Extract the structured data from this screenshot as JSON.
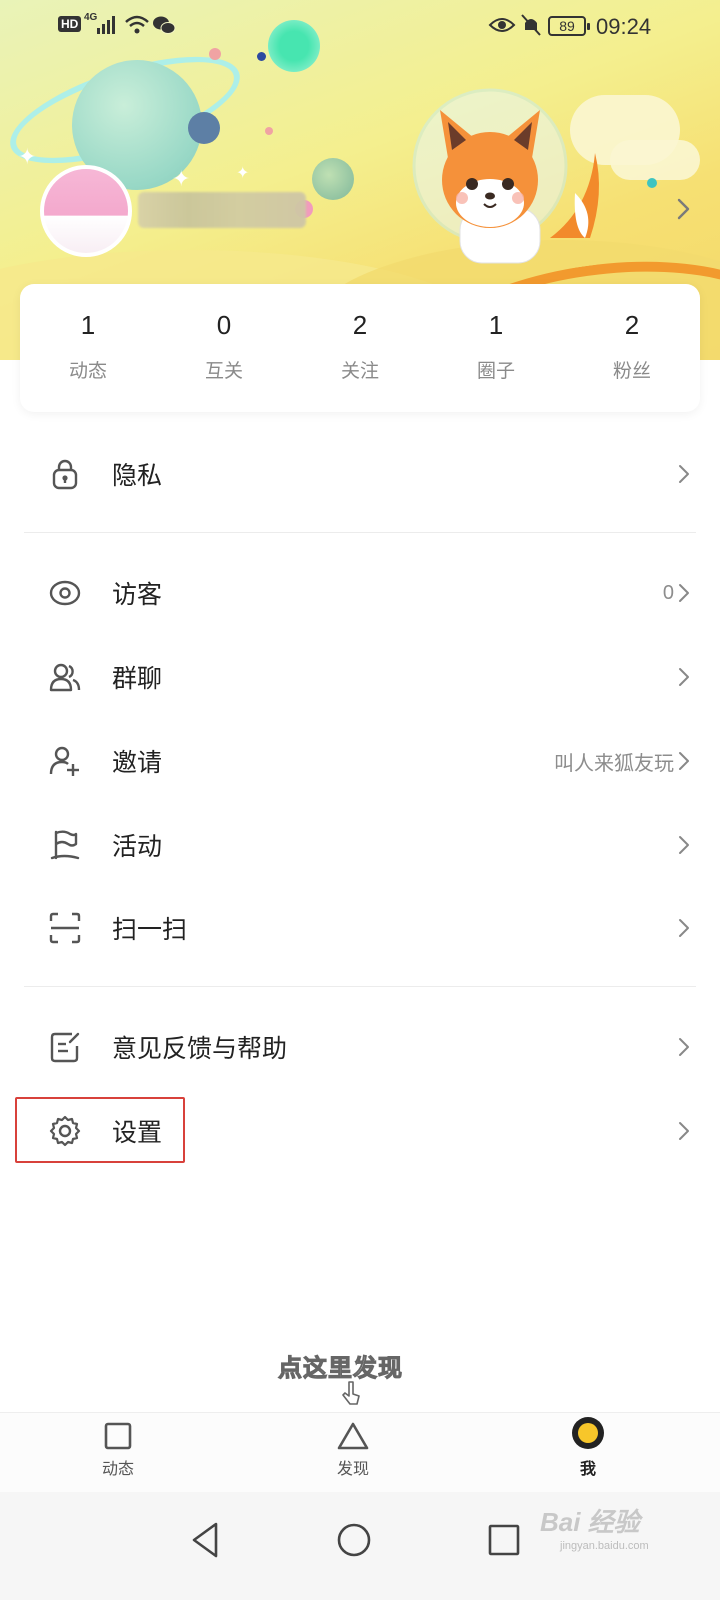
{
  "status_bar": {
    "hd_label": "HD",
    "network": "4G",
    "battery": "89",
    "time": "09:24"
  },
  "stats": [
    {
      "value": "1",
      "label": "动态"
    },
    {
      "value": "0",
      "label": "互关"
    },
    {
      "value": "2",
      "label": "关注"
    },
    {
      "value": "1",
      "label": "圈子"
    },
    {
      "value": "2",
      "label": "粉丝"
    }
  ],
  "menu": {
    "privacy": {
      "label": "隐私"
    },
    "visitors": {
      "label": "访客",
      "count": "0"
    },
    "group_chat": {
      "label": "群聊"
    },
    "invite": {
      "label": "邀请",
      "hint": "叫人来狐友玩"
    },
    "activity": {
      "label": "活动"
    },
    "scan": {
      "label": "扫一扫"
    },
    "feedback": {
      "label": "意见反馈与帮助"
    },
    "settings": {
      "label": "设置"
    }
  },
  "hint_text": "点这里发现",
  "bottom_nav": [
    {
      "label": "动态",
      "icon": "square-icon"
    },
    {
      "label": "发现",
      "icon": "triangle-icon"
    },
    {
      "label": "我",
      "icon": "me-dot-icon"
    }
  ],
  "watermark": {
    "main": "Bai 经验",
    "sub": "jingyan.baidu.com"
  },
  "colors": {
    "highlight_border": "#d8413b",
    "me_dot": "#f7c62a",
    "banner_yellow": "#f4ef8e"
  }
}
